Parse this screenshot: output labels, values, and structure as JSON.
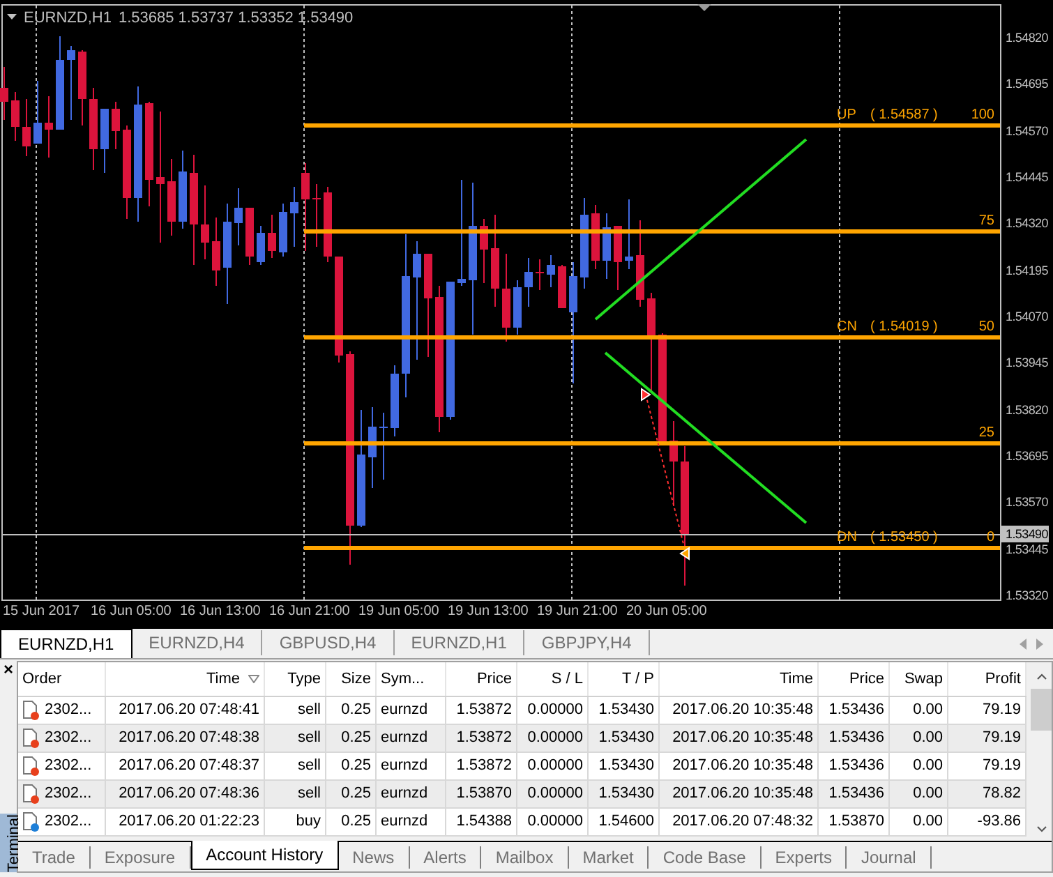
{
  "chart": {
    "title": "EURNZD,H1",
    "ohlc": "1.53685 1.53737 1.53352 1.53490",
    "price_axis": [
      "1.54820",
      "1.54695",
      "1.54570",
      "1.54445",
      "1.54320",
      "1.54195",
      "1.54070",
      "1.53945",
      "1.53820",
      "1.53695",
      "1.53570",
      "1.53445",
      "1.53320"
    ],
    "current_price": "1.53490",
    "levels": [
      {
        "name": "UP",
        "price": "( 1.54587 )",
        "percent": "100"
      },
      {
        "percent": "75"
      },
      {
        "name": "CN",
        "price": "( 1.54019 )",
        "percent": "50"
      },
      {
        "percent": "25"
      },
      {
        "name": "DN",
        "price": "( 1.53450 )",
        "percent": "0"
      }
    ],
    "time_axis": [
      "15 Jun 2017",
      "16 Jun 05:00",
      "16 Jun 13:00",
      "16 Jun 21:00",
      "19 Jun 05:00",
      "19 Jun 13:00",
      "19 Jun 21:00",
      "20 Jun 05:00"
    ]
  },
  "chart_tabs": [
    {
      "label": "EURNZD,H1",
      "selected": true
    },
    {
      "label": "EURNZD,H4",
      "selected": false
    },
    {
      "label": "GBPUSD,H4",
      "selected": false
    },
    {
      "label": "EURNZD,H1",
      "selected": false
    },
    {
      "label": "GBPJPY,H4",
      "selected": false
    }
  ],
  "terminal": {
    "title": "Terminal",
    "close": "×",
    "columns": [
      "Order",
      "Time",
      "Type",
      "Size",
      "Sym...",
      "Price",
      "S / L",
      "T / P",
      "Time",
      "Price",
      "Swap",
      "Profit"
    ],
    "rows": [
      {
        "kind": "sell",
        "cells": [
          "2302...",
          "2017.06.20 07:48:41",
          "sell",
          "0.25",
          "eurnzd",
          "1.53872",
          "0.00000",
          "1.53430",
          "2017.06.20 10:35:48",
          "1.53436",
          "0.00",
          "79.19"
        ]
      },
      {
        "kind": "sell",
        "cells": [
          "2302...",
          "2017.06.20 07:48:38",
          "sell",
          "0.25",
          "eurnzd",
          "1.53872",
          "0.00000",
          "1.53430",
          "2017.06.20 10:35:48",
          "1.53436",
          "0.00",
          "79.19"
        ]
      },
      {
        "kind": "sell",
        "cells": [
          "2302...",
          "2017.06.20 07:48:37",
          "sell",
          "0.25",
          "eurnzd",
          "1.53872",
          "0.00000",
          "1.53430",
          "2017.06.20 10:35:48",
          "1.53436",
          "0.00",
          "79.19"
        ]
      },
      {
        "kind": "sell",
        "cells": [
          "2302...",
          "2017.06.20 07:48:36",
          "sell",
          "0.25",
          "eurnzd",
          "1.53870",
          "0.00000",
          "1.53430",
          "2017.06.20 10:35:48",
          "1.53436",
          "0.00",
          "78.82"
        ]
      },
      {
        "kind": "buy",
        "cells": [
          "2302...",
          "2017.06.20 01:22:23",
          "buy",
          "0.25",
          "eurnzd",
          "1.54388",
          "0.00000",
          "1.54600",
          "2017.06.20 07:48:32",
          "1.53870",
          "0.00",
          "-93.86"
        ]
      }
    ],
    "tabs": [
      {
        "label": "Trade",
        "selected": false
      },
      {
        "label": "Exposure",
        "selected": false
      },
      {
        "label": "Account History",
        "selected": true
      },
      {
        "label": "News",
        "selected": false
      },
      {
        "label": "Alerts",
        "selected": false
      },
      {
        "label": "Mailbox",
        "selected": false
      },
      {
        "label": "Market",
        "selected": false
      },
      {
        "label": "Code Base",
        "selected": false
      },
      {
        "label": "Experts",
        "selected": false
      },
      {
        "label": "Journal",
        "selected": false
      }
    ]
  }
}
